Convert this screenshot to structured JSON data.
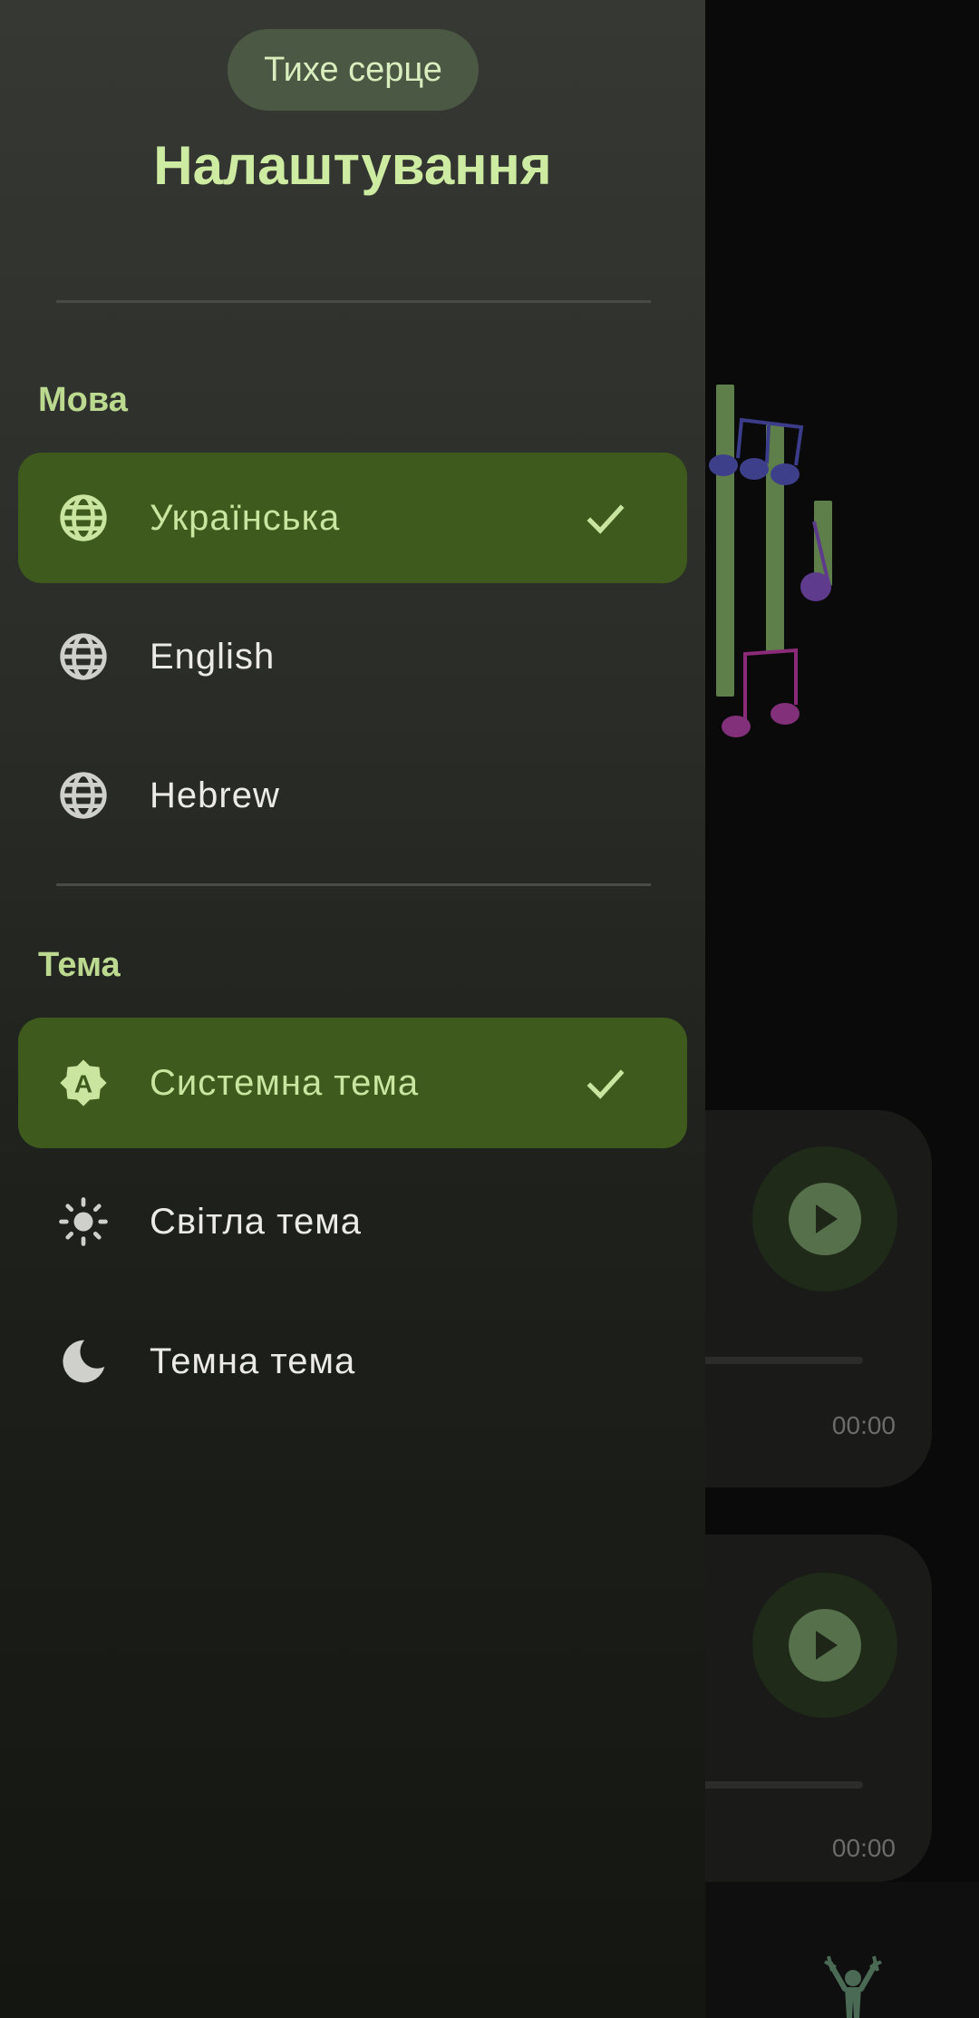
{
  "drawer": {
    "app_name": "Тихе серце",
    "title": "Налаштування"
  },
  "language": {
    "section_label": "Мова",
    "items": [
      {
        "label": "Українська",
        "icon": "globe-icon",
        "selected": true
      },
      {
        "label": "English",
        "icon": "globe-icon",
        "selected": false
      },
      {
        "label": "Hebrew",
        "icon": "globe-icon",
        "selected": false
      }
    ]
  },
  "theme": {
    "section_label": "Тема",
    "items": [
      {
        "label": "Системна тема",
        "icon": "auto-brightness-icon",
        "selected": true
      },
      {
        "label": "Світла тема",
        "icon": "sun-icon",
        "selected": false
      },
      {
        "label": "Темна тема",
        "icon": "moon-icon",
        "selected": false
      }
    ]
  },
  "background": {
    "tracks": [
      {
        "time": "00:00"
      },
      {
        "time": "00:00"
      }
    ]
  },
  "colors": {
    "accent": "#cdeba1",
    "selected_bg": "#3e5a1c"
  }
}
